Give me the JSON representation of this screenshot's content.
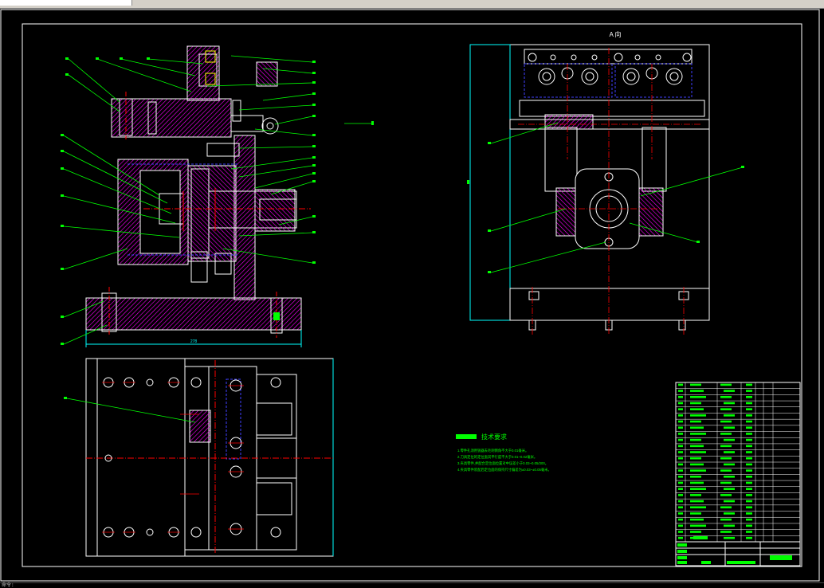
{
  "window": {
    "tab_label": ""
  },
  "view_title": "A 向",
  "dimension_width": "278",
  "tech_requirements": {
    "heading": "技术要求",
    "lines": [
      "1.零件孔须用锐器去毛刺倒角不大于0.01毫米。",
      "2.刀具定位的定位面其平行度不大于0.01~0.02毫米。",
      "3.夹具零件,并配合定位面位置对中误差小于0.03~0.05/300。",
      "4.夹具零件装配后定位面的保持尺寸偏差为±0.03~±0.05毫米。"
    ]
  },
  "status_text": "命令:",
  "colors": {
    "frame": "#ffffff",
    "lines": "#ffffff",
    "hatch": "#ff00ff",
    "center": "#ff0000",
    "leader": "#00ff00",
    "hidden": "#4040ff",
    "dimension": "#00ffff",
    "yellow": "#ffff00"
  }
}
